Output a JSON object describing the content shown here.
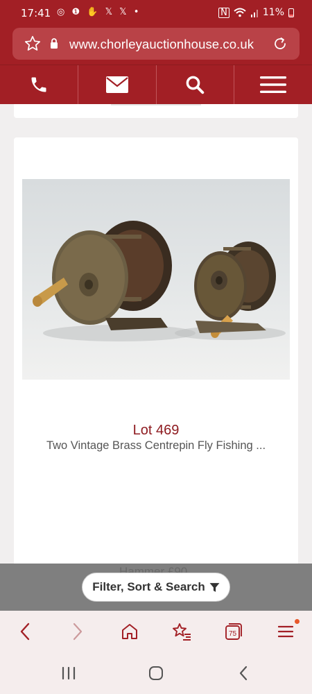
{
  "status_bar": {
    "time": "17:41",
    "notifications": "◎ ❶ ✋ 𝕏 𝕏 •",
    "battery": "11%"
  },
  "browser": {
    "url": "www.chorleyauctionhouse.co.uk"
  },
  "site_nav": {
    "items": [
      "phone-icon",
      "mail-icon",
      "search-icon",
      "menu-icon"
    ]
  },
  "lot": {
    "title": "Lot 469",
    "description": "Two Vintage Brass Centrepin Fly Fishing ...",
    "image_alt": "Two vintage brass centrepin fly fishing reels"
  },
  "filter": {
    "hammer_text": "Hammer £90",
    "button_label": "Filter, Sort & Search"
  },
  "browser_toolbar": {
    "tab_count": "75"
  },
  "colors": {
    "brand_red": "#a21f25",
    "lot_title": "#8e1b20",
    "notification_dot": "#e8572a"
  }
}
